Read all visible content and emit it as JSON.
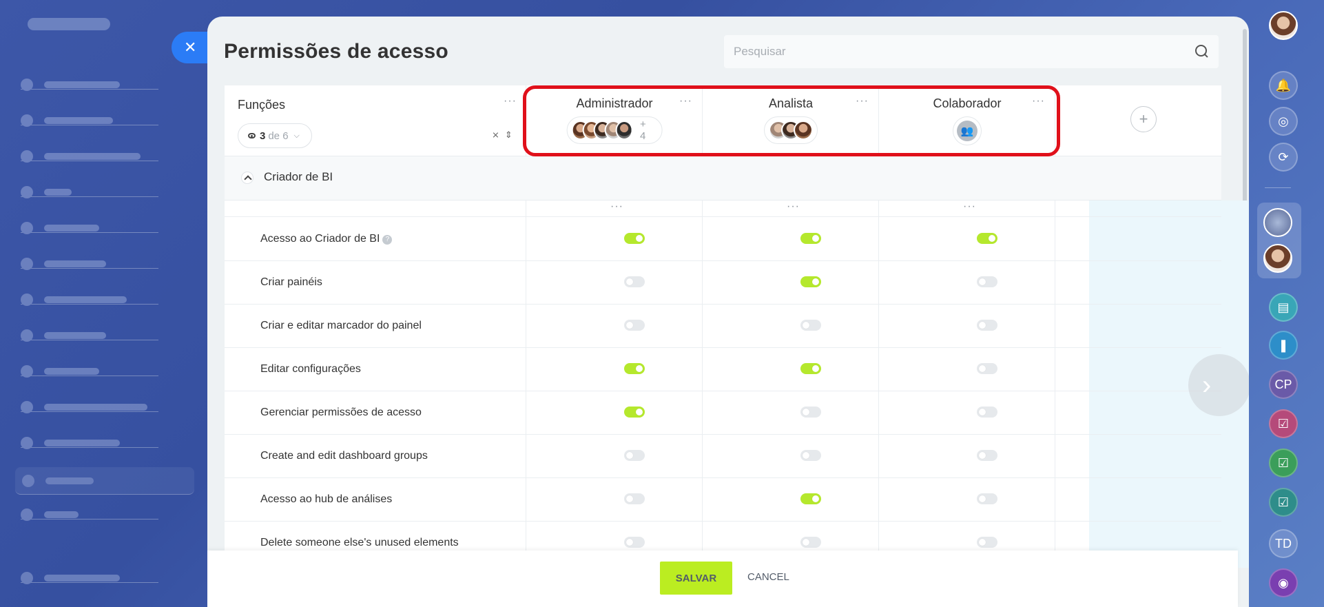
{
  "panel": {
    "title": "Permissões de acesso"
  },
  "search": {
    "placeholder": "Pesquisar"
  },
  "functions": {
    "title": "Funções",
    "filter_count": "3",
    "filter_of": "de 6"
  },
  "roles": [
    {
      "name": "Administrador",
      "extra_members": "+ 4"
    },
    {
      "name": "Analista"
    },
    {
      "name": "Colaborador"
    }
  ],
  "section": {
    "title": "Criador de BI"
  },
  "permissions": [
    {
      "label": "Acesso ao Criador de BI",
      "values": [
        true,
        true,
        true
      ],
      "help": "?"
    },
    {
      "label": "Criar painéis",
      "values": [
        false,
        true,
        false
      ]
    },
    {
      "label": "Criar e editar marcador do painel",
      "values": [
        false,
        false,
        false
      ]
    },
    {
      "label": "Editar configurações",
      "values": [
        true,
        true,
        false
      ]
    },
    {
      "label": "Gerenciar permissões de acesso",
      "values": [
        true,
        false,
        false
      ]
    },
    {
      "label": "Create and edit dashboard groups",
      "values": [
        false,
        false,
        false
      ]
    },
    {
      "label": "Acesso ao hub de análises",
      "values": [
        false,
        true,
        false
      ]
    },
    {
      "label": "Delete someone else's unused elements",
      "values": [
        false,
        false,
        false
      ]
    }
  ],
  "footer": {
    "save_label": "SALVAR",
    "cancel_label": "CANCEL"
  },
  "right_bar": {
    "cp_label": "CP",
    "td_label": "TD"
  },
  "colors": {
    "accent": "#bbed21",
    "toggle_on": "#b5e82d",
    "highlight": "#e0101a",
    "close": "#2b7cf6"
  }
}
